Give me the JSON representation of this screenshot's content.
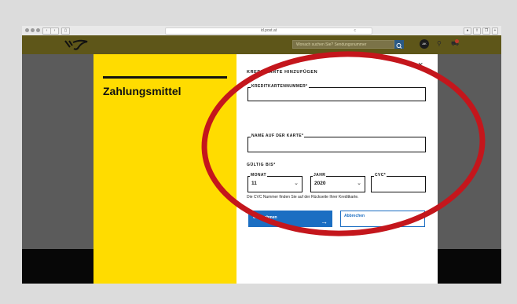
{
  "browser": {
    "url": "id.post.at",
    "reload_icon": "c"
  },
  "site": {
    "search_placeholder": "Wonach suchen Sie? Sendungsnummer",
    "avatar_initials": "AK"
  },
  "modal": {
    "left_title": "Zahlungsmittel",
    "close_label": "×",
    "heading": "KREDITKARTE HINZUFÜGEN",
    "fields": {
      "card_number_label": "KREDITKARTENNUMMER*",
      "name_label": "NAME AUF DER KARTE*"
    },
    "expiry": {
      "section_label": "GÜLTIG BIS*",
      "month_label": "MONAT",
      "month_value": "11",
      "year_label": "JAHR",
      "year_value": "2020",
      "cvc_label": "CVC*"
    },
    "hint": "Die CVC Nummer finden Sie auf der Rückseite Ihrer Kreditkarte.",
    "buttons": {
      "submit": "Übernehmen",
      "cancel": "Abbrechen"
    }
  },
  "colors": {
    "brand_yellow": "#ffdc00",
    "primary_blue": "#1b6ec2",
    "annotation_red": "#c4161c"
  }
}
